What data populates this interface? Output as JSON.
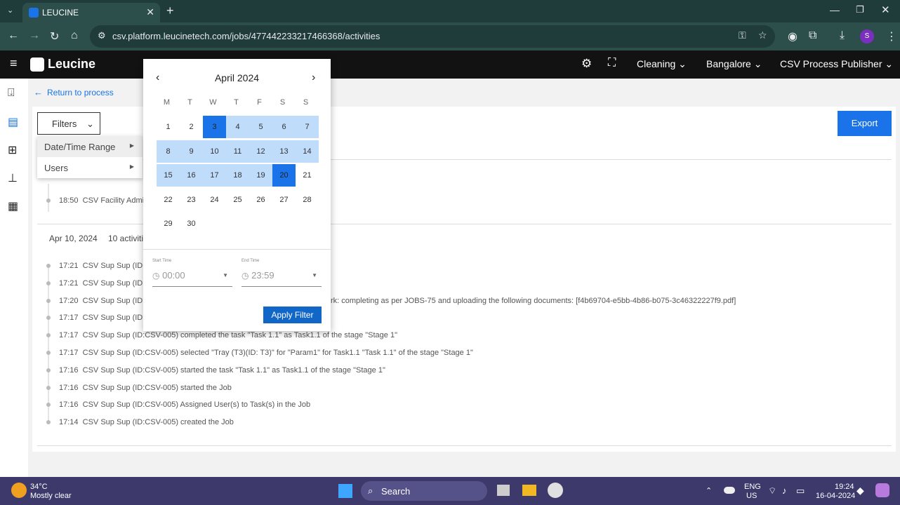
{
  "browser": {
    "tab_title": "LEUCINE",
    "url": "csv.platform.leucinetech.com/jobs/477442233217466368/activities",
    "profile_initial": "S"
  },
  "header": {
    "brand": "Leucine",
    "facility": "Cleaning",
    "location": "Bangalore",
    "role": "CSV Process Publisher"
  },
  "main": {
    "back_link": "Return to process",
    "filters_label": "Filters",
    "export_label": "Export",
    "filter_menu": [
      {
        "label": "Date/Time Range"
      },
      {
        "label": "Users"
      }
    ],
    "partial_activity": {
      "time": "18:50",
      "text": "CSV Facility Admin"
    },
    "day_group": {
      "date": "Apr 10, 2024",
      "count": "10 activiti"
    },
    "activities": [
      {
        "time": "17:21",
        "text": "CSV Sup Sup (ID:C"
      },
      {
        "time": "17:21",
        "text": "CSV Sup Sup (ID:C"
      },
      {
        "time": "17:20",
        "text": "CSV Sup Sup (ID:C",
        "tail": "rk: completing as per JOBS-75 and uploading the following documents: [f4b69704-e5bb-4b86-b075-3c46322227f9.pdf]"
      },
      {
        "time": "17:17",
        "text": "CSV Sup Sup (ID:C"
      },
      {
        "time": "17:17",
        "text": "CSV Sup Sup (ID:CSV-005) completed the task \"Task 1.1\" as Task1.1 of the stage \"Stage 1\""
      },
      {
        "time": "17:17",
        "text": "CSV Sup Sup (ID:CSV-005) selected \"Tray (T3)(ID: T3)\" for \"Param1\" for Task1.1 \"Task 1.1\" of the stage \"Stage 1\""
      },
      {
        "time": "17:16",
        "text": "CSV Sup Sup (ID:CSV-005) started the task \"Task 1.1\" as Task1.1 of the stage \"Stage 1\""
      },
      {
        "time": "17:16",
        "text": "CSV Sup Sup (ID:CSV-005) started the Job"
      },
      {
        "time": "17:16",
        "text": "CSV Sup Sup (ID:CSV-005) Assigned User(s) to Task(s) in the Job"
      },
      {
        "time": "17:14",
        "text": "CSV Sup Sup (ID:CSV-005) created the Job"
      }
    ]
  },
  "calendar": {
    "month": "April 2024",
    "weekdays": [
      "M",
      "T",
      "W",
      "T",
      "F",
      "S",
      "S"
    ],
    "weeks": [
      [
        "1",
        "2",
        "3",
        "4",
        "5",
        "6",
        "7"
      ],
      [
        "8",
        "9",
        "10",
        "11",
        "12",
        "13",
        "14"
      ],
      [
        "15",
        "16",
        "17",
        "18",
        "19",
        "20",
        "21"
      ],
      [
        "22",
        "23",
        "24",
        "25",
        "26",
        "27",
        "28"
      ],
      [
        "29",
        "30"
      ]
    ],
    "range_start": 3,
    "range_end": 20,
    "start_time_label": "Start Time",
    "start_time": "00:00",
    "end_time_label": "End Time",
    "end_time": "23:59",
    "apply_label": "Apply Filter"
  },
  "taskbar": {
    "temp": "34°C",
    "weather": "Mostly clear",
    "search": "Search",
    "lang1": "ENG",
    "lang2": "US",
    "time": "19:24",
    "date": "16-04-2024"
  }
}
